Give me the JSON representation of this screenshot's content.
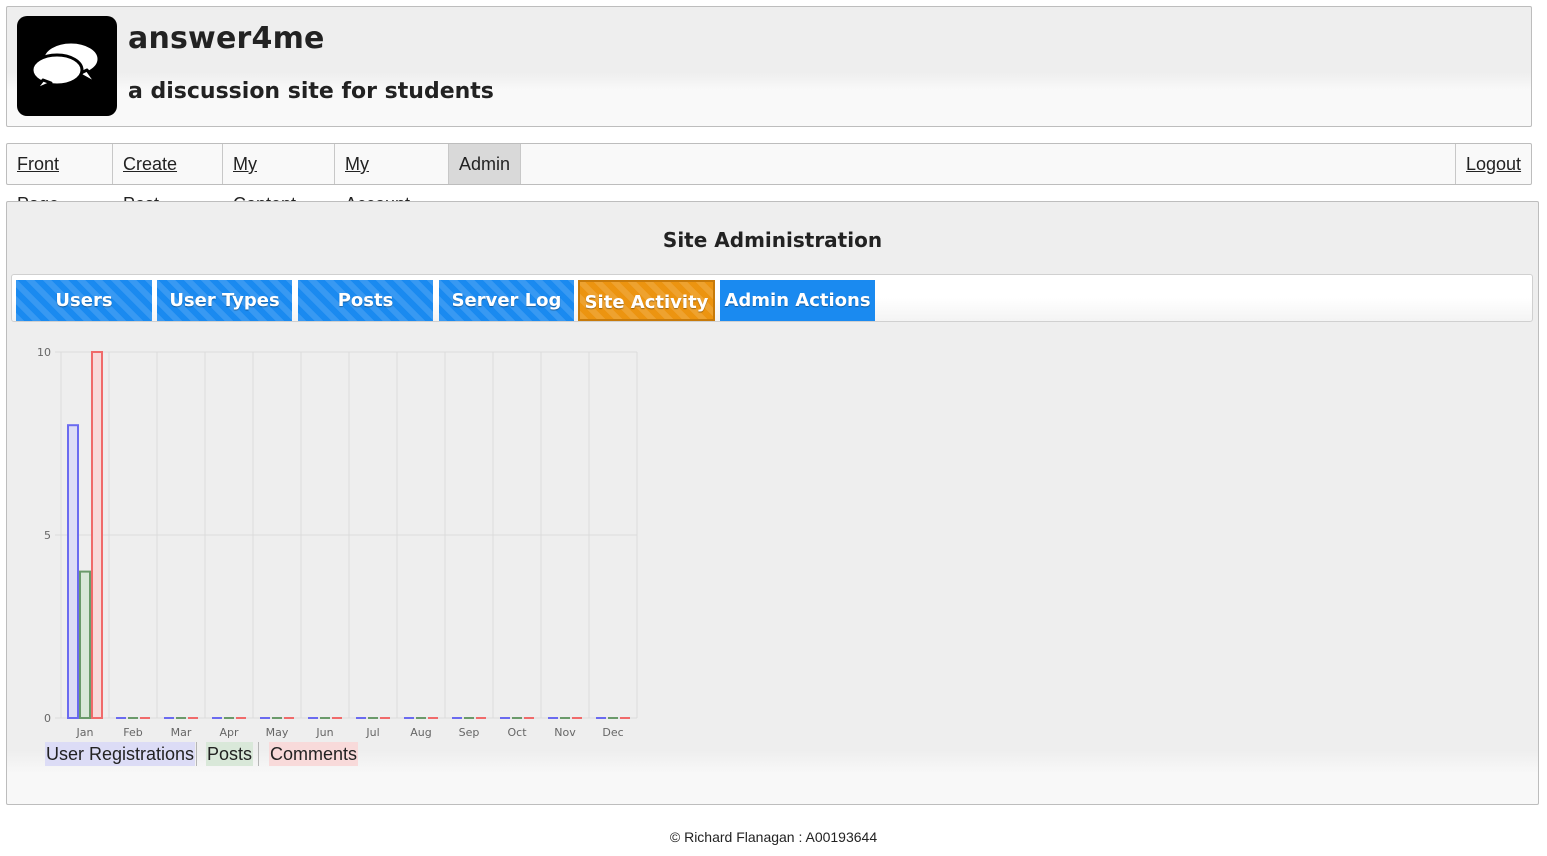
{
  "header": {
    "title": "answer4me",
    "tagline": "a discussion site for students",
    "logo_icon": "speech-bubbles-icon"
  },
  "nav": {
    "items": [
      {
        "label": "Front Page",
        "active": false
      },
      {
        "label": "Create Post",
        "active": false
      },
      {
        "label": "My Content",
        "active": false
      },
      {
        "label": "My Account",
        "active": false
      },
      {
        "label": "Admin",
        "active": true
      }
    ],
    "logout_label": "Logout"
  },
  "main": {
    "title": "Site Administration",
    "tabs": [
      {
        "label": "Users",
        "active": false
      },
      {
        "label": "User Types",
        "active": false
      },
      {
        "label": "Posts",
        "active": false
      },
      {
        "label": "Server Log",
        "active": false
      },
      {
        "label": "Site Activity",
        "active": true
      },
      {
        "label": "Admin Actions",
        "active": false
      }
    ]
  },
  "colors": {
    "tab_blue": "#1a8af0",
    "tab_active_orange": "#ec9410",
    "series_registrations": "#6a6af0",
    "series_posts": "#6a9a6a",
    "series_comments": "#f06a6a"
  },
  "chart_data": {
    "type": "bar",
    "categories": [
      "Jan",
      "Feb",
      "Mar",
      "Apr",
      "May",
      "Jun",
      "Jul",
      "Aug",
      "Sep",
      "Oct",
      "Nov",
      "Dec"
    ],
    "series": [
      {
        "name": "User Registrations",
        "values": [
          8,
          0,
          0,
          0,
          0,
          0,
          0,
          0,
          0,
          0,
          0,
          0
        ],
        "stroke": "#6a6af0",
        "fill": "#dcdcf6"
      },
      {
        "name": "Posts",
        "values": [
          4,
          0,
          0,
          0,
          0,
          0,
          0,
          0,
          0,
          0,
          0,
          0
        ],
        "stroke": "#6a9a6a",
        "fill": "#d9e8d9"
      },
      {
        "name": "Comments",
        "values": [
          10,
          0,
          0,
          0,
          0,
          0,
          0,
          0,
          0,
          0,
          0,
          0
        ],
        "stroke": "#f06a6a",
        "fill": "#f8dada"
      }
    ],
    "yticks": [
      "0",
      "5",
      "10"
    ],
    "ylim": [
      0,
      10
    ],
    "grid": true,
    "legend_position": "bottom-left"
  },
  "footer": {
    "text": "© Richard Flanagan : A00193644"
  }
}
